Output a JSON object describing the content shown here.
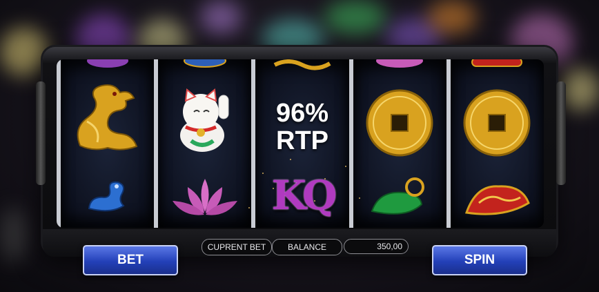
{
  "reels": {
    "center_text": {
      "line1": "96%",
      "line2": "RTP"
    },
    "symbols": [
      {
        "top": "purple-icon",
        "middle": "golden-dragon-icon",
        "bottom": "blue-fish-icon"
      },
      {
        "top": "blue-icon",
        "middle": "lucky-cat-icon",
        "bottom": "pink-lotus-icon"
      },
      {
        "top": "gold-dragon-icon",
        "middle": "rtp-text",
        "bottom": "kq-letters-icon"
      },
      {
        "top": "pink-lotus-icon",
        "middle": "gold-coin-icon",
        "bottom": "jade-pendant-icon"
      },
      {
        "top": "red-ornament-icon",
        "middle": "gold-coin-icon",
        "bottom": "red-fan-icon"
      }
    ],
    "kq_text": "KQ"
  },
  "controls": {
    "bet_label": "BET",
    "spin_label": "SPIN",
    "current_bet_label": "CUPRENT BET",
    "balance_label": "BALANCE",
    "balance_value": "350,00"
  },
  "colors": {
    "button_blue": "#2340b8",
    "reel_divider": "#c9ccd3",
    "gold": "#e3b22b"
  }
}
